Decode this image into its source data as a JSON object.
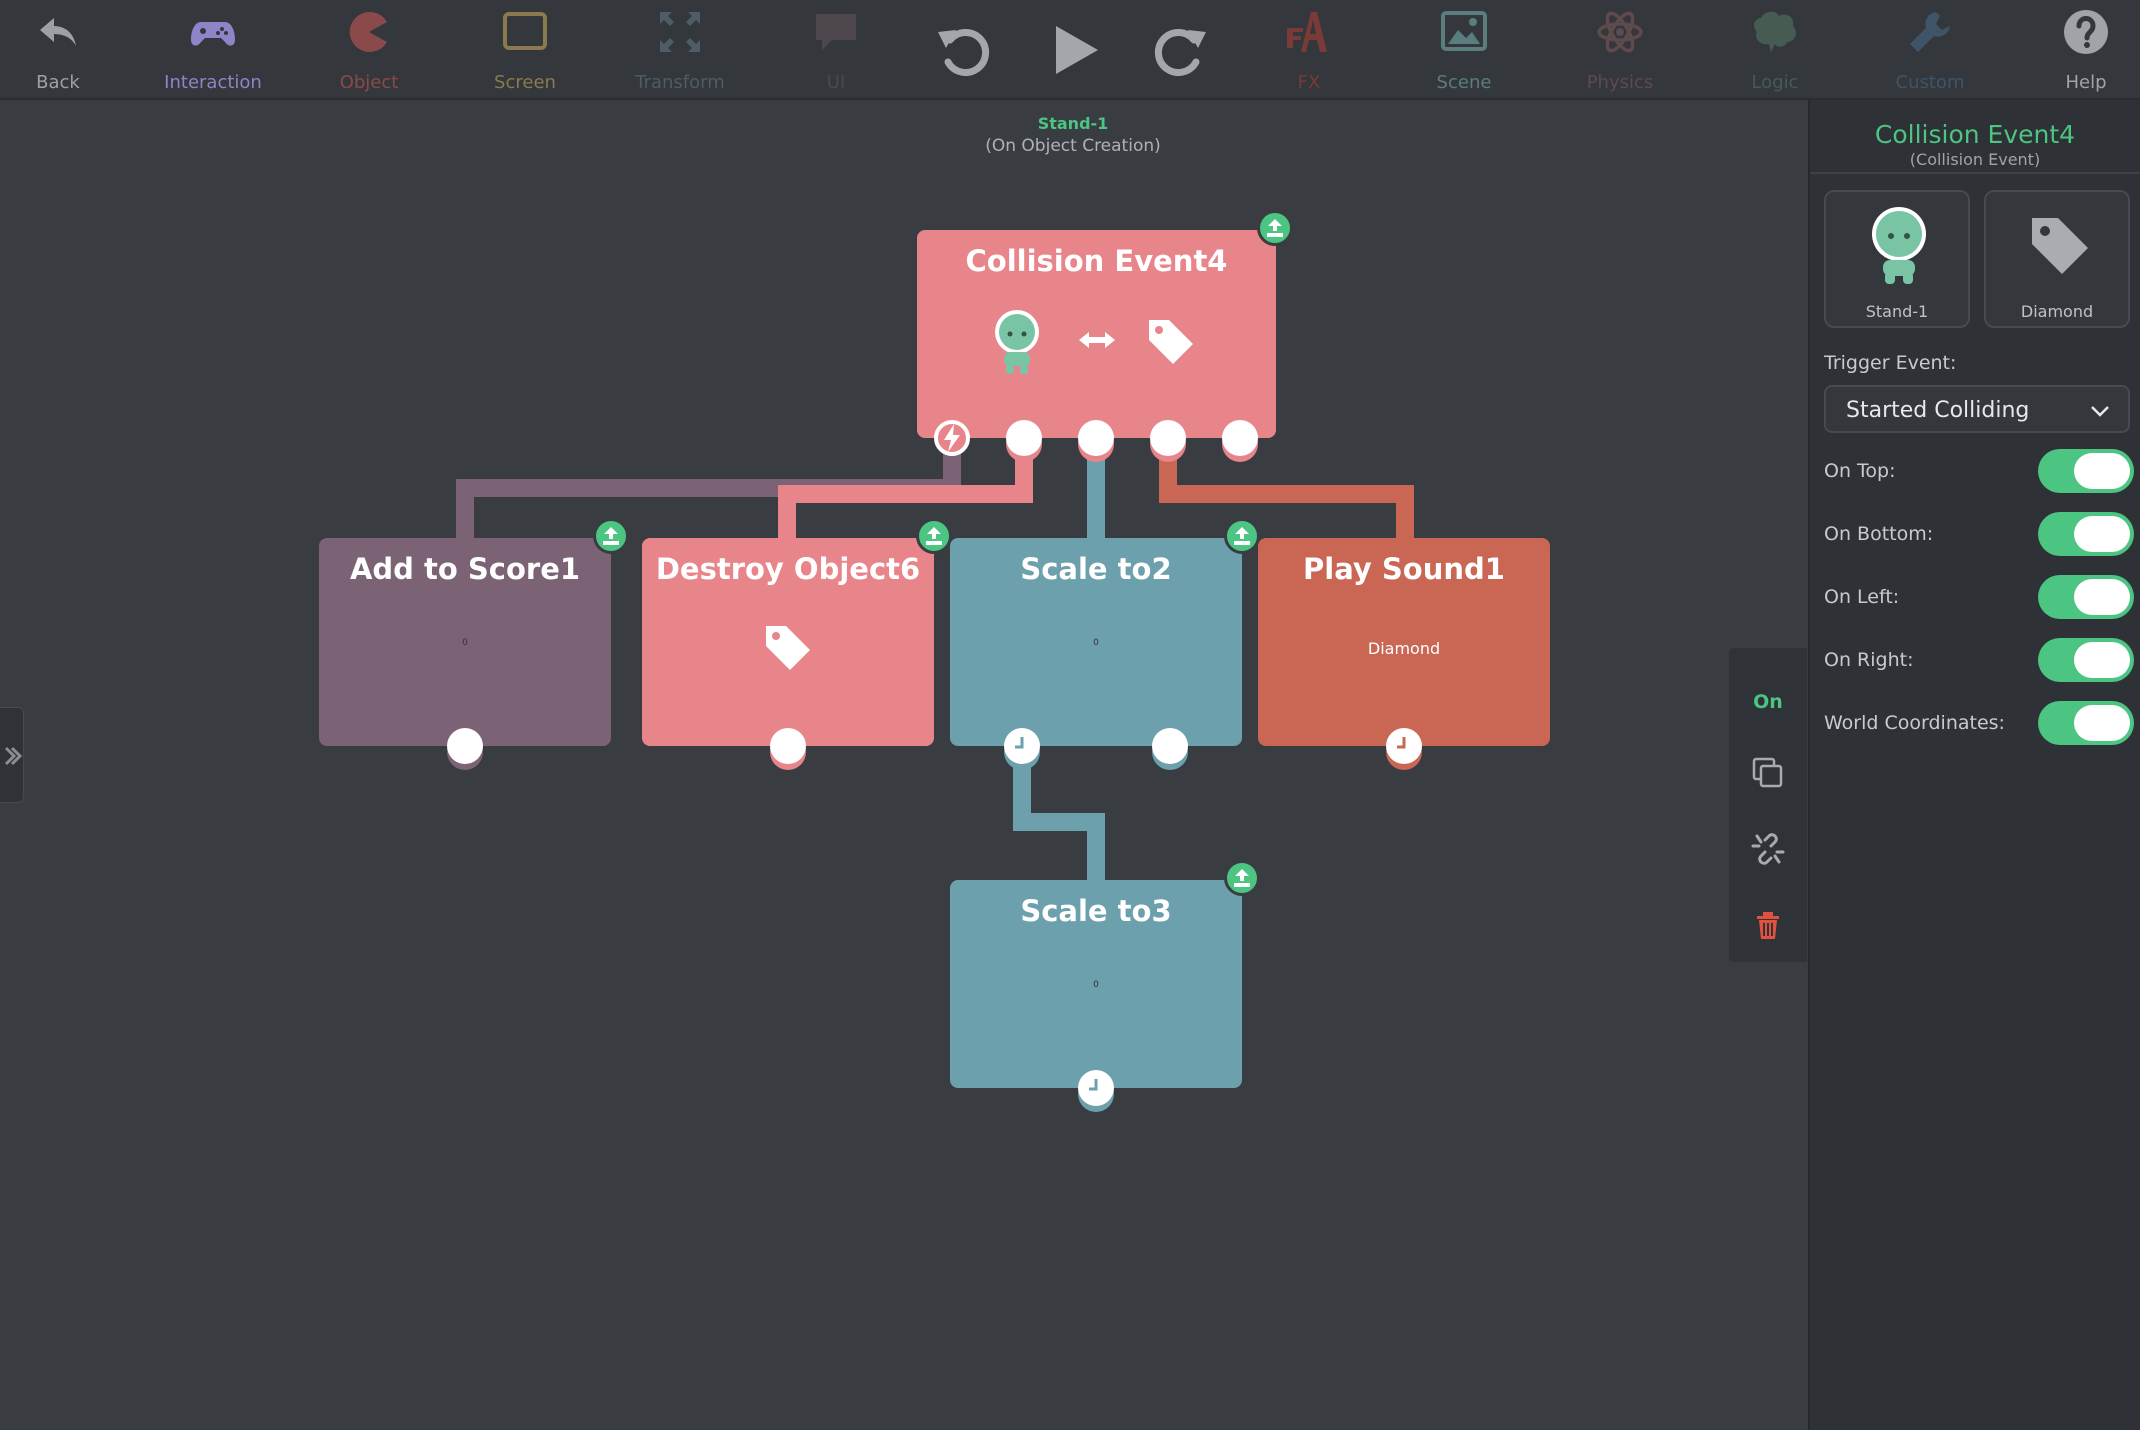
{
  "toolbar": {
    "tools": [
      {
        "label": "Back",
        "icon": "back-arrow-icon",
        "color": "#9da1a5"
      },
      {
        "label": "Interaction",
        "icon": "gamepad-icon",
        "color": "#8f84c8"
      },
      {
        "label": "Object",
        "icon": "pacman-icon",
        "color": "#8a4a4a"
      },
      {
        "label": "Screen",
        "icon": "screen-icon",
        "color": "#8a7a4e"
      },
      {
        "label": "Transform",
        "icon": "transform-icon",
        "color": "#4e5c66"
      },
      {
        "label": "UI",
        "icon": "speech-bubble-icon",
        "color": "#4e474e"
      },
      {
        "label": "FX",
        "icon": "fx-icon",
        "color": "#7a3a38"
      },
      {
        "label": "Scene",
        "icon": "scene-icon",
        "color": "#5a7d7e"
      },
      {
        "label": "Physics",
        "icon": "atom-icon",
        "color": "#5f4a4e"
      },
      {
        "label": "Logic",
        "icon": "brain-icon",
        "color": "#465c52"
      },
      {
        "label": "Custom",
        "icon": "wrench-icon",
        "color": "#3f5468"
      },
      {
        "label": "Help",
        "icon": "help-icon",
        "color": "#a0a4a8"
      }
    ],
    "undo_icon": "undo-icon",
    "play_icon": "play-icon",
    "redo_icon": "redo-icon"
  },
  "canvas": {
    "object_name": "Stand-1",
    "context": "(On Object Creation)"
  },
  "nodes": {
    "collision": {
      "title": "Collision Event4",
      "color": "#e8858a"
    },
    "score": {
      "title": "Add to Score1",
      "value": "0",
      "color": "#7b6275"
    },
    "destroy": {
      "title": "Destroy Object6",
      "color": "#e8858a"
    },
    "scale2": {
      "title": "Scale to2",
      "value": "0",
      "color": "#6ba0ac"
    },
    "sound": {
      "title": "Play Sound1",
      "caption": "Diamond",
      "color": "#c96654"
    },
    "scale3": {
      "title": "Scale to3",
      "value": "0",
      "color": "#6ba0ac"
    }
  },
  "actions": {
    "on_label": "On",
    "copy_icon": "copy-icon",
    "unlink_icon": "unlink-icon",
    "delete_icon": "trash-icon"
  },
  "inspector": {
    "title": "Collision Event4",
    "subtitle": "(Collision Event)",
    "object_a": "Stand-1",
    "object_b": "Diamond",
    "trigger_label": "Trigger Event:",
    "trigger_value": "Started Colliding",
    "toggles": [
      {
        "label": "On Top:",
        "on": true
      },
      {
        "label": "On Bottom:",
        "on": true
      },
      {
        "label": "On Left:",
        "on": true
      },
      {
        "label": "On Right:",
        "on": true
      },
      {
        "label": "World Coordinates:",
        "on": true
      }
    ]
  },
  "colors": {
    "accent": "#4cc482",
    "coral": "#e8858a",
    "plum": "#7b6275",
    "teal": "#6ba0ac",
    "rust": "#c96654"
  }
}
